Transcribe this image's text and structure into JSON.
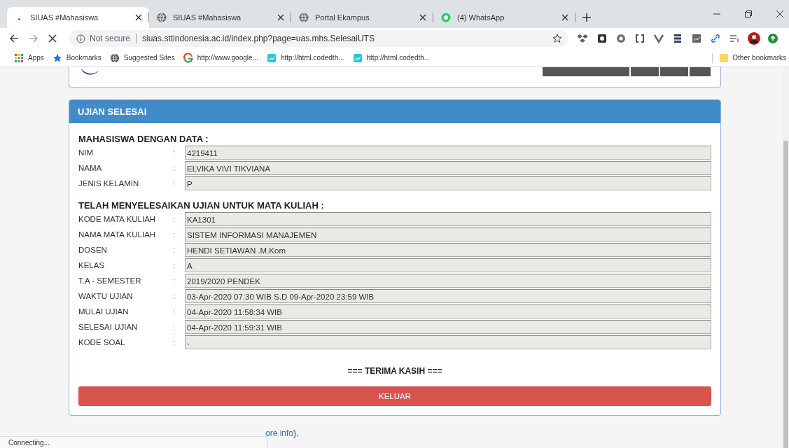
{
  "browser": {
    "tabs": [
      {
        "title": "SIUAS #Mahasiswa",
        "selected": true,
        "kind": "loading"
      },
      {
        "title": "SIUAS #Mahasiswa",
        "selected": false,
        "kind": "globe"
      },
      {
        "title": "Portal Ekampus",
        "selected": false,
        "kind": "globe"
      },
      {
        "title": "(4) WhatsApp",
        "selected": false,
        "kind": "chat"
      }
    ],
    "security_label": "Not secure",
    "address": "siuas.sttindonesia.ac.id/index.php?page=uas.mhs.SelesaiUTS",
    "bookmarks": [
      {
        "label": "Apps",
        "kind": "grid"
      },
      {
        "label": "Bookmarks",
        "kind": "star"
      },
      {
        "label": "Suggested Sites",
        "kind": "globe"
      },
      {
        "label": "http://www.google...",
        "kind": "ring"
      },
      {
        "label": "http://html.codedth...",
        "kind": "chart"
      },
      {
        "label": "http://html.codedth...",
        "kind": "chart"
      }
    ],
    "other_bookmarks": "Other bookmarks",
    "status_text": "Connecting..."
  },
  "panel": {
    "title": "UJIAN SELESAI",
    "sections": [
      {
        "heading": "MAHASISWA DENGAN DATA :",
        "rows": [
          {
            "label": "NIM",
            "value": "4219411"
          },
          {
            "label": "NAMA",
            "value": "ELVIKA VIVI TIKVIANA"
          },
          {
            "label": "JENIS KELAMIN",
            "value": "P"
          }
        ]
      },
      {
        "heading": "TELAH MENYELESAIKAN UJIAN UNTUK MATA KULIAH :",
        "rows": [
          {
            "label": "KODE MATA KULIAH",
            "value": "KA1301"
          },
          {
            "label": "NAMA MATA KULIAH",
            "value": "SISTEM INFORMASI MANAJEMEN"
          },
          {
            "label": "DOSEN",
            "value": "HENDI SETIAWAN .M.Kom"
          },
          {
            "label": "KELAS",
            "value": "A"
          },
          {
            "label": "T.A - SEMESTER",
            "value": "2019/2020 PENDEK"
          },
          {
            "label": "WAKTU UJIAN",
            "value": "03-Apr-2020 07:30 WIB S.D 09-Apr-2020 23:59 WIB"
          },
          {
            "label": "MULAI UJIAN",
            "value": "04-Apr-2020 11:58:34 WIB"
          },
          {
            "label": "SELESAI UJIAN",
            "value": "04-Apr-2020 11:59:31 WIB"
          },
          {
            "label": "KODE SOAL",
            "value": "-"
          }
        ]
      }
    ],
    "separator": ":",
    "thanks": "=== TERIMA KASIH ===",
    "button": "KELUAR"
  },
  "footer": {
    "link": "ore info",
    "tail": ")."
  }
}
